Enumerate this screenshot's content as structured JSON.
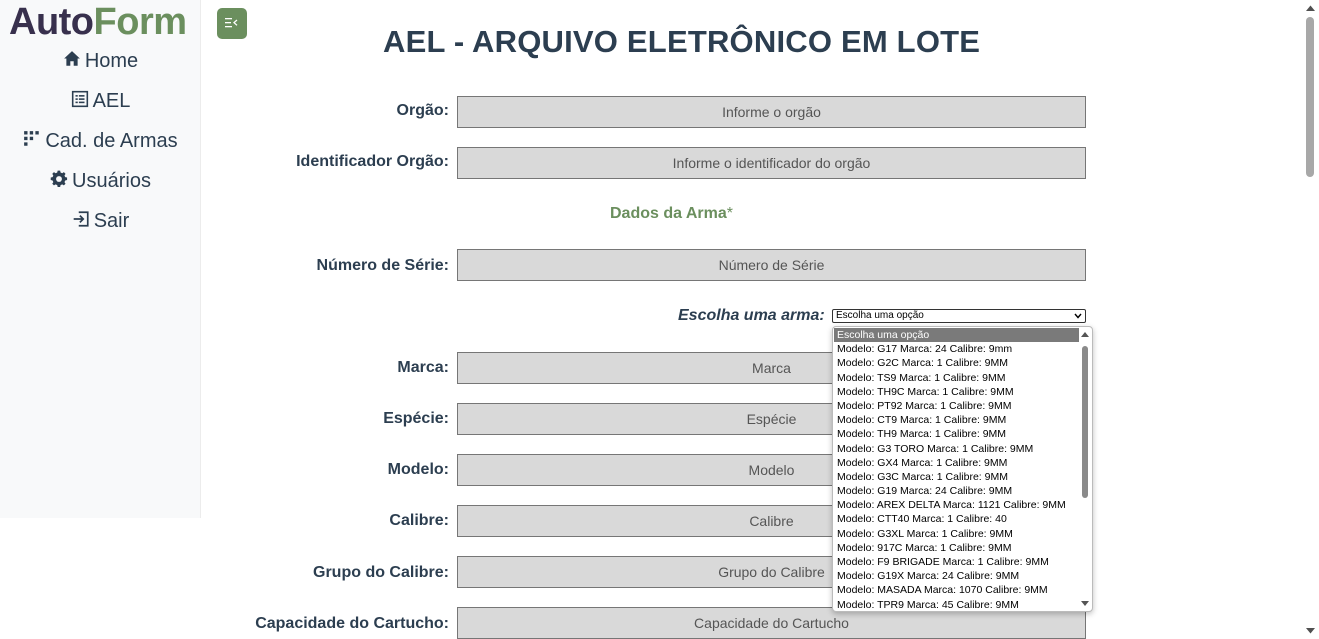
{
  "brand": {
    "part1": "Auto",
    "part2": "Form"
  },
  "nav": [
    {
      "label": "Home",
      "icon": "home-icon"
    },
    {
      "label": "AEL",
      "icon": "list-icon"
    },
    {
      "label": "Cad. de Armas",
      "icon": "grid-icon"
    },
    {
      "label": "Usuários",
      "icon": "gear-icon"
    },
    {
      "label": "Sair",
      "icon": "logout-icon"
    }
  ],
  "page_title": "AEL - ARQUIVO ELETRÔNICO EM LOTE",
  "fields": {
    "orgao": {
      "label": "Orgão:",
      "placeholder": "Informe o orgão"
    },
    "identificador": {
      "label": "Identificador Orgão:",
      "placeholder": "Informe o identificador do orgão"
    },
    "numero_serie": {
      "label": "Número de Série:",
      "placeholder": "Número de Série"
    },
    "marca": {
      "label": "Marca:",
      "placeholder": "Marca"
    },
    "especie": {
      "label": "Espécie:",
      "placeholder": "Espécie"
    },
    "modelo": {
      "label": "Modelo:",
      "placeholder": "Modelo"
    },
    "calibre": {
      "label": "Calibre:",
      "placeholder": "Calibre"
    },
    "grupo_calibre": {
      "label": "Grupo do Calibre:",
      "placeholder": "Grupo do Calibre"
    },
    "capacidade": {
      "label": "Capacidade do Cartucho:",
      "placeholder": "Capacidade do Cartucho"
    }
  },
  "section": {
    "title": "Dados da Arma",
    "required_mark": "*"
  },
  "weapon_select": {
    "label": "Escolha uma arma:",
    "selected": "Escolha uma opção",
    "options": [
      "Escolha uma opção",
      "Modelo: G17 Marca: 24 Calibre: 9mm",
      "Modelo: G2C Marca: 1 Calibre: 9MM",
      "Modelo: TS9 Marca: 1 Calibre: 9MM",
      "Modelo: TH9C Marca: 1 Calibre: 9MM",
      "Modelo: PT92 Marca: 1 Calibre: 9MM",
      "Modelo: CT9 Marca: 1 Calibre: 9MM",
      "Modelo: TH9 Marca: 1 Calibre: 9MM",
      "Modelo: G3 TORO Marca: 1 Calibre: 9MM",
      "Modelo: GX4 Marca: 1 Calibre: 9MM",
      "Modelo: G3C Marca: 1 Calibre: 9MM",
      "Modelo: G19 Marca: 24 Calibre: 9MM",
      "Modelo: AREX DELTA Marca: 1121 Calibre: 9MM",
      "Modelo: CTT40 Marca: 1 Calibre: 40",
      "Modelo: G3XL Marca: 1 Calibre: 9MM",
      "Modelo: 917C Marca: 1 Calibre: 9MM",
      "Modelo: F9 BRIGADE Marca: 1 Calibre: 9MM",
      "Modelo: G19X Marca: 24 Calibre: 9MM",
      "Modelo: MASADA Marca: 1070 Calibre: 9MM",
      "Modelo: TPR9 Marca: 45 Calibre: 9MM"
    ]
  },
  "colors": {
    "accent": "#6b8f5e",
    "brand_dark": "#38304d",
    "text": "#2c3e50",
    "input_bg": "#d9d9d9"
  }
}
